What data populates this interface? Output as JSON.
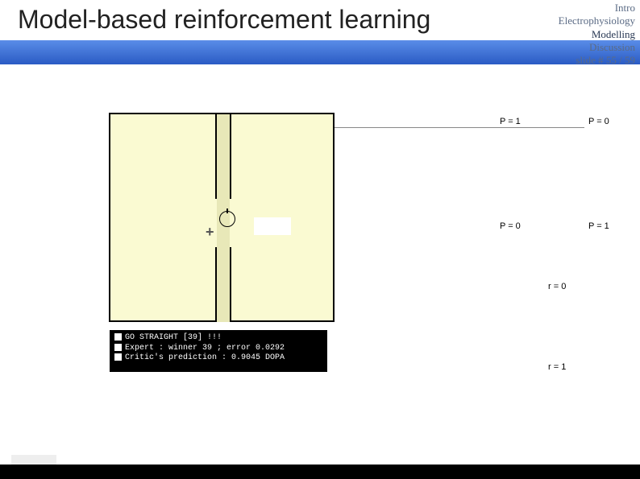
{
  "header": {
    "title": "Model-based reinforcement learning"
  },
  "nav": {
    "items": [
      "Intro",
      "Electrophysiology",
      "Modelling",
      "Discussion"
    ],
    "slide_label": "slide # 55 / 59"
  },
  "maze": {
    "plus_symbol": "+"
  },
  "console": {
    "line1": "GO STRAIGHT [39] !!!",
    "line2": "Expert : winner 39 ; error 0.0292",
    "line3": "Critic's prediction : 0.9045 DOPA"
  },
  "labels": {
    "p_eq_1_a": "P = 1",
    "p_eq_0_a": "P = 0",
    "p_eq_0_b": "P = 0",
    "p_eq_1_b": "P = 1",
    "r_eq_0": "r = 0",
    "r_eq_1": "r = 1"
  }
}
